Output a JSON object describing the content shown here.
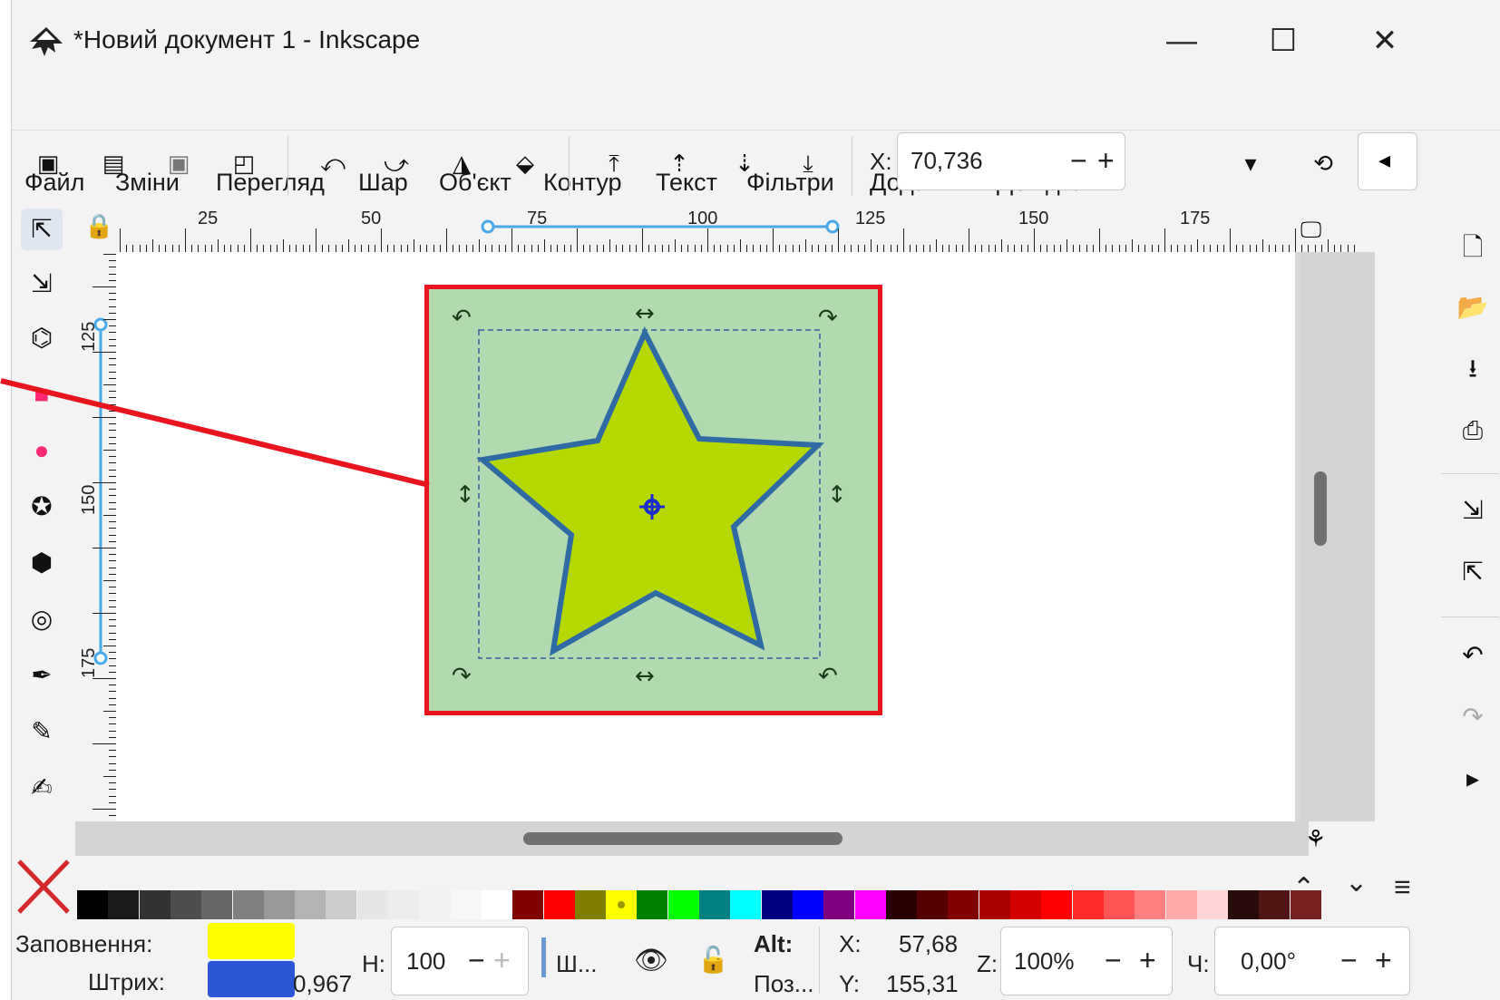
{
  "window": {
    "title": "*Новий документ 1 - Inkscape",
    "app_icon": "inkscape-logo-icon",
    "minimize": "—",
    "maximize": "☐",
    "close": "✕"
  },
  "menu": [
    "Файл",
    "Зміни",
    "Перегляд",
    "Шар",
    "Об'єкт",
    "Контур",
    "Текст",
    "Фільтри",
    "Додатки",
    "Довідка"
  ],
  "toolbar": {
    "x_label": "X:",
    "x_value": "70,736",
    "minus": "−",
    "plus": "+"
  },
  "ruler": {
    "h_labels": [
      "25",
      "50",
      "75",
      "100",
      "125",
      "150",
      "175"
    ],
    "v_labels": [
      "125",
      "150",
      "175"
    ]
  },
  "palette_colors": [
    "#000000",
    "#1a1a1a",
    "#333333",
    "#4d4d4d",
    "#666666",
    "#808080",
    "#999999",
    "#b3b3b3",
    "#cccccc",
    "#e6e6e6",
    "#ececec",
    "#f2f2f2",
    "#f7f7f7",
    "#ffffff",
    "#800000",
    "#ff0000",
    "#808000",
    "#ffff00",
    "#008000",
    "#00ff00",
    "#008080",
    "#00ffff",
    "#000080",
    "#0000ff",
    "#800080",
    "#ff00ff",
    "#2b0000",
    "#550000",
    "#800000",
    "#aa0000",
    "#d40000",
    "#ff0000",
    "#ff2a2a",
    "#ff5555",
    "#ff8080",
    "#ffaaaa",
    "#ffd5d5",
    "#280b0b",
    "#501616",
    "#782121"
  ],
  "status": {
    "fill_label": "Заповнення:",
    "stroke_label": "Штрих:",
    "fill_color": "#ffff00",
    "stroke_color": "#2b55d4",
    "stroke_width": "0,967",
    "h_label": "Н:",
    "h_value": "100",
    "layer_label": "Ш...",
    "alt_label": "Alt:",
    "pos_label": "Поз...",
    "x_label": "X:",
    "x_value": "57,68",
    "y_label": "Y:",
    "y_value": "155,31",
    "z_label": "Z:",
    "zoom_value": "100%",
    "r_label": "Ч:",
    "rotation_value": "0,00°",
    "minus": "−",
    "plus": "+"
  }
}
